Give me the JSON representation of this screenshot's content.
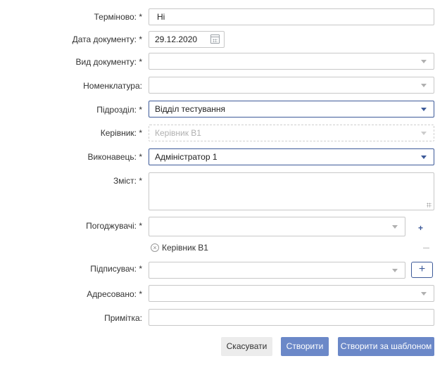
{
  "form": {
    "urgent": {
      "label": "Терміново: *",
      "value": "Ні"
    },
    "doc_date": {
      "label": "Дата документу: *",
      "value": "29.12.2020",
      "icon": "calendar-icon"
    },
    "doc_type": {
      "label": "Вид документу: *",
      "value": ""
    },
    "nomenclature": {
      "label": "Номенклатура:",
      "value": ""
    },
    "department": {
      "label": "Підрозділ: *",
      "value": "Відділ тестування"
    },
    "head": {
      "label": "Керівник: *",
      "value": "Керівник В1"
    },
    "executor": {
      "label": "Виконавець: *",
      "value": "Адміністратор 1"
    },
    "content": {
      "label": "Зміст: *",
      "value": ""
    },
    "approvers": {
      "label": "Погоджувачі: *",
      "value": "",
      "add_label": "+",
      "tags": [
        {
          "text": "Керівник В1"
        }
      ]
    },
    "signer": {
      "label": "Підписувач: *",
      "value": "",
      "add_label": "+"
    },
    "addressed": {
      "label": "Адресовано: *",
      "value": ""
    },
    "note": {
      "label": "Примітка:",
      "value": ""
    }
  },
  "buttons": {
    "cancel": "Скасувати",
    "create": "Створити",
    "create_template": "Створити за шаблоном"
  },
  "colors": {
    "accent": "#3d5a99",
    "primary_button": "#6b88c8",
    "secondary_button": "#ececec"
  }
}
